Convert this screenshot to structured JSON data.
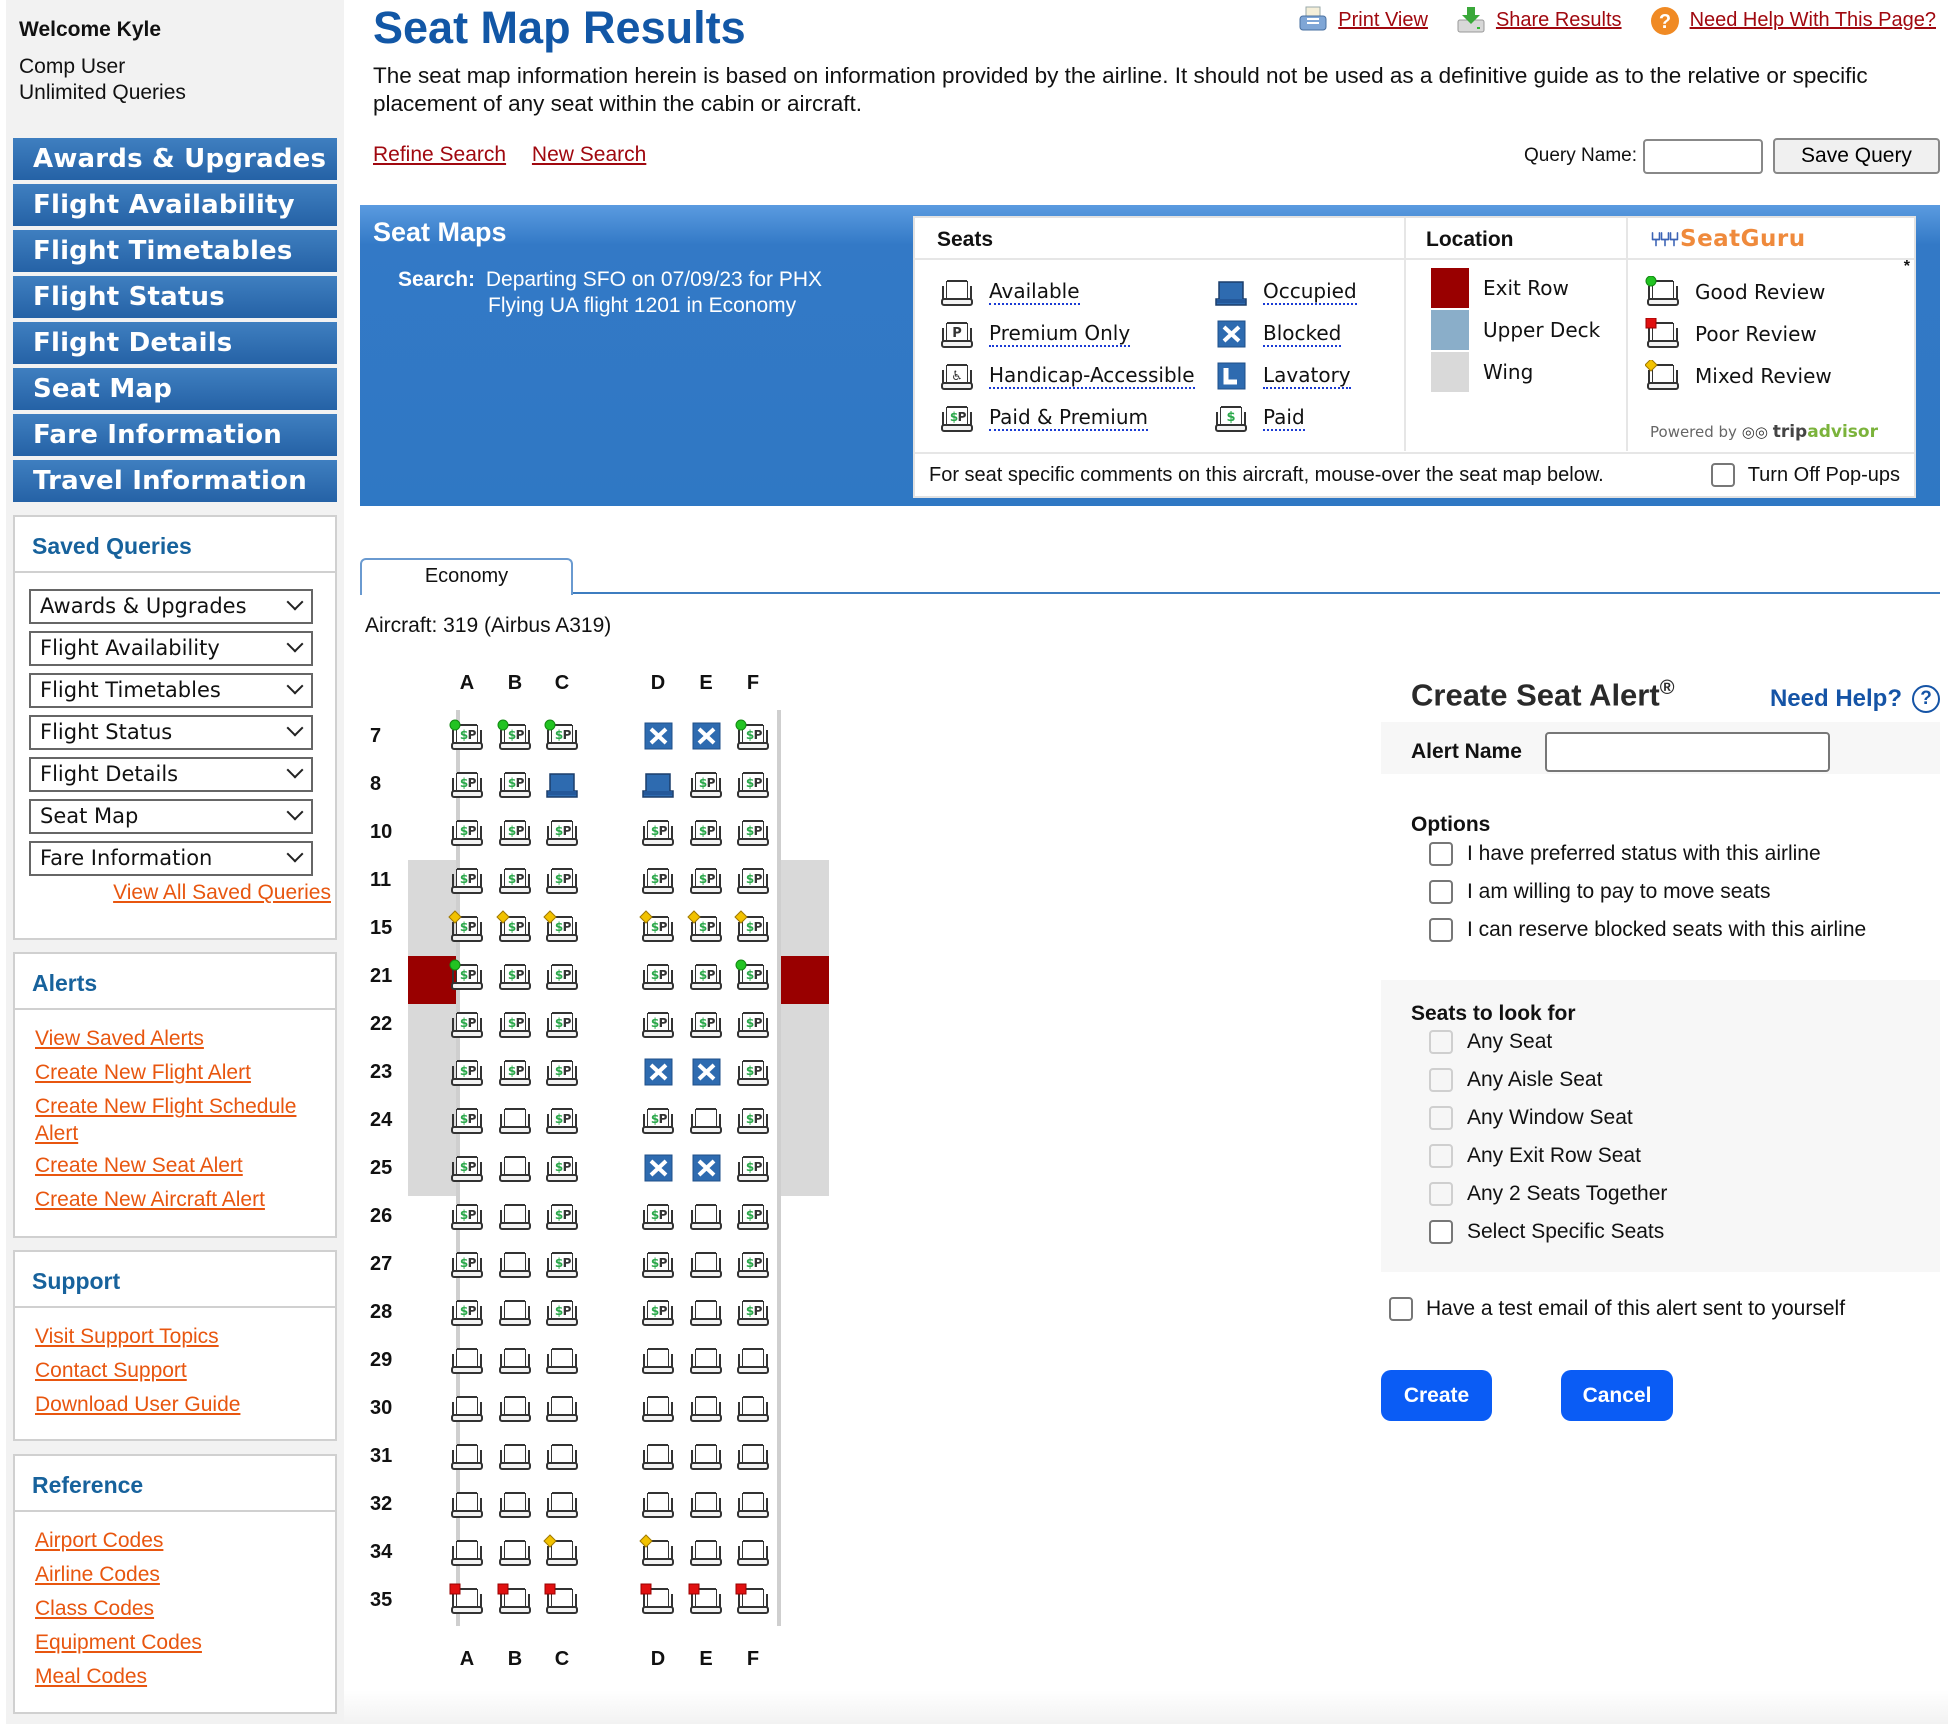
{
  "sidebar": {
    "welcome": "Welcome Kyle",
    "user_type": "Comp User",
    "query_plan": "Unlimited Queries",
    "nav": [
      "Awards & Upgrades",
      "Flight Availability",
      "Flight Timetables",
      "Flight Status",
      "Flight Details",
      "Seat Map",
      "Fare Information",
      "Travel Information"
    ],
    "saved_queries": {
      "title": "Saved Queries",
      "selects": [
        "Awards & Upgrades",
        "Flight Availability",
        "Flight Timetables",
        "Flight Status",
        "Flight Details",
        "Seat Map",
        "Fare Information"
      ],
      "view_all": "View All Saved Queries"
    },
    "alerts": {
      "title": "Alerts",
      "links": [
        "View Saved Alerts",
        "Create New Flight Alert",
        "Create New Flight Schedule Alert",
        "Create New Seat Alert",
        "Create New Aircraft Alert"
      ]
    },
    "support": {
      "title": "Support",
      "links": [
        "Visit Support Topics",
        "Contact Support",
        "Download User Guide"
      ]
    },
    "reference": {
      "title": "Reference",
      "links": [
        "Airport Codes",
        "Airline Codes",
        "Class Codes",
        "Equipment Codes",
        "Meal Codes"
      ]
    }
  },
  "header": {
    "title": "Seat Map Results",
    "print_view": "Print View",
    "share_results": "Share Results",
    "need_help": "Need Help With This Page?",
    "disclaimer": "The seat map information herein is based on information provided by the airline. It should not be used as a definitive guide as to the relative or specific placement of any seat within the cabin or aircraft.",
    "refine_search": "Refine Search",
    "new_search": "New Search",
    "query_name_label": "Query Name:",
    "query_name_value": "",
    "save_query": "Save Query"
  },
  "panel": {
    "title": "Seat Maps",
    "search_label": "Search:",
    "search_line1": "Departing SFO on 07/09/23 for PHX",
    "search_line2": "Flying UA flight 1201 in Economy"
  },
  "legend": {
    "seats_header": "Seats",
    "location_header": "Location",
    "seatguru_brand": "SeatGuru",
    "seats": [
      {
        "icon": "available",
        "label": "Available"
      },
      {
        "icon": "premium",
        "label": "Premium Only"
      },
      {
        "icon": "handicap",
        "label": "Handicap-Accessible"
      },
      {
        "icon": "paidpremium",
        "label": "Paid & Premium"
      },
      {
        "icon": "occupied",
        "label": "Occupied"
      },
      {
        "icon": "blocked",
        "label": "Blocked"
      },
      {
        "icon": "lavatory",
        "label": "Lavatory"
      },
      {
        "icon": "paid",
        "label": "Paid"
      }
    ],
    "locations": [
      {
        "label": "Exit Row",
        "color": "#990000"
      },
      {
        "label": "Upper Deck",
        "color": "#8aaec9"
      },
      {
        "label": "Wing",
        "color": "#d9d9d9"
      }
    ],
    "reviews": [
      {
        "label": "Good Review",
        "marker": "good"
      },
      {
        "label": "Poor Review",
        "marker": "poor"
      },
      {
        "label": "Mixed Review",
        "marker": "mixed"
      }
    ],
    "asterisk": "*",
    "powered_by": "Powered by",
    "tripadvisor_a": "trip",
    "tripadvisor_b": "advisor",
    "footer_note": "For seat specific comments on this aircraft, mouse-over the seat map below.",
    "popups_label": "Turn Off Pop-ups",
    "popups_checked": false
  },
  "cabin": {
    "tab": "Economy",
    "aircraft": "Aircraft: 319 (Airbus A319)",
    "columns": [
      "A",
      "B",
      "C",
      "D",
      "E",
      "F"
    ],
    "rows": [
      {
        "num": "7",
        "zone": "none",
        "seats": [
          "pp:good",
          "pp:good",
          "pp:good",
          "blocked",
          "blocked",
          "pp:good"
        ]
      },
      {
        "num": "8",
        "zone": "none",
        "seats": [
          "pp",
          "pp",
          "occupied",
          "occupied",
          "pp",
          "pp"
        ]
      },
      {
        "num": "10",
        "zone": "none",
        "seats": [
          "pp",
          "pp",
          "pp",
          "pp",
          "pp",
          "pp"
        ]
      },
      {
        "num": "11",
        "zone": "wing",
        "seats": [
          "pp",
          "pp",
          "pp",
          "pp",
          "pp",
          "pp"
        ]
      },
      {
        "num": "15",
        "zone": "wing",
        "seats": [
          "pp:mixed",
          "pp:mixed",
          "pp:mixed",
          "pp:mixed",
          "pp:mixed",
          "pp:mixed"
        ]
      },
      {
        "num": "21",
        "zone": "exit",
        "seats": [
          "pp:good",
          "pp",
          "pp",
          "pp",
          "pp",
          "pp:good"
        ]
      },
      {
        "num": "22",
        "zone": "wing",
        "seats": [
          "pp",
          "pp",
          "pp",
          "pp",
          "pp",
          "pp"
        ]
      },
      {
        "num": "23",
        "zone": "wing",
        "seats": [
          "pp",
          "pp",
          "pp",
          "blocked",
          "blocked",
          "pp"
        ]
      },
      {
        "num": "24",
        "zone": "wing",
        "seats": [
          "pp",
          "available",
          "pp",
          "pp",
          "available",
          "pp"
        ]
      },
      {
        "num": "25",
        "zone": "wing",
        "seats": [
          "pp",
          "available",
          "pp",
          "blocked",
          "blocked",
          "pp"
        ]
      },
      {
        "num": "26",
        "zone": "none",
        "seats": [
          "pp",
          "available",
          "pp",
          "pp",
          "available",
          "pp"
        ]
      },
      {
        "num": "27",
        "zone": "none",
        "seats": [
          "pp",
          "available",
          "pp",
          "pp",
          "available",
          "pp"
        ]
      },
      {
        "num": "28",
        "zone": "none",
        "seats": [
          "pp",
          "available",
          "pp",
          "pp",
          "available",
          "pp"
        ]
      },
      {
        "num": "29",
        "zone": "none",
        "seats": [
          "available",
          "available",
          "available",
          "available",
          "available",
          "available"
        ]
      },
      {
        "num": "30",
        "zone": "none",
        "seats": [
          "available",
          "available",
          "available",
          "available",
          "available",
          "available"
        ]
      },
      {
        "num": "31",
        "zone": "none",
        "seats": [
          "available",
          "available",
          "available",
          "available",
          "available",
          "available"
        ]
      },
      {
        "num": "32",
        "zone": "none",
        "seats": [
          "available",
          "available",
          "available",
          "available",
          "available",
          "available"
        ]
      },
      {
        "num": "34",
        "zone": "none",
        "seats": [
          "available",
          "available",
          "available:mixed",
          "available:mixed",
          "available",
          "available"
        ]
      },
      {
        "num": "35",
        "zone": "none",
        "seats": [
          "available:poor",
          "available:poor",
          "available:poor",
          "available:poor",
          "available:poor",
          "available:poor"
        ]
      }
    ]
  },
  "seat_alert": {
    "title": "Create Seat Alert",
    "registered": "®",
    "need_help": "Need Help?",
    "alert_name_label": "Alert Name",
    "alert_name_value": "",
    "options_title": "Options",
    "options": [
      {
        "label": "I have preferred status with this airline",
        "checked": false
      },
      {
        "label": "I am willing to pay to move seats",
        "checked": false
      },
      {
        "label": "I can reserve blocked seats with this airline",
        "checked": false
      }
    ],
    "seats_title": "Seats to look for",
    "seat_choices": [
      {
        "label": "Any Seat",
        "checked": false,
        "disabled": true
      },
      {
        "label": "Any Aisle Seat",
        "checked": false,
        "disabled": true
      },
      {
        "label": "Any Window Seat",
        "checked": false,
        "disabled": true
      },
      {
        "label": "Any Exit Row Seat",
        "checked": false,
        "disabled": true
      },
      {
        "label": "Any 2 Seats Together",
        "checked": false,
        "disabled": true
      },
      {
        "label": "Select Specific Seats",
        "checked": false,
        "disabled": false
      }
    ],
    "test_email": "Have a test email of this alert sent to yourself",
    "create": "Create",
    "cancel": "Cancel"
  },
  "colors": {
    "nav_blue": "#2f6fb4",
    "heading_blue": "#1257a6",
    "link_red": "#a0080f",
    "link_orange": "#e8560f",
    "exit_row": "#990000",
    "wing": "#d9d9d9",
    "button_blue": "#0a5cf5",
    "occupied_blue": "#2e6bb0"
  }
}
